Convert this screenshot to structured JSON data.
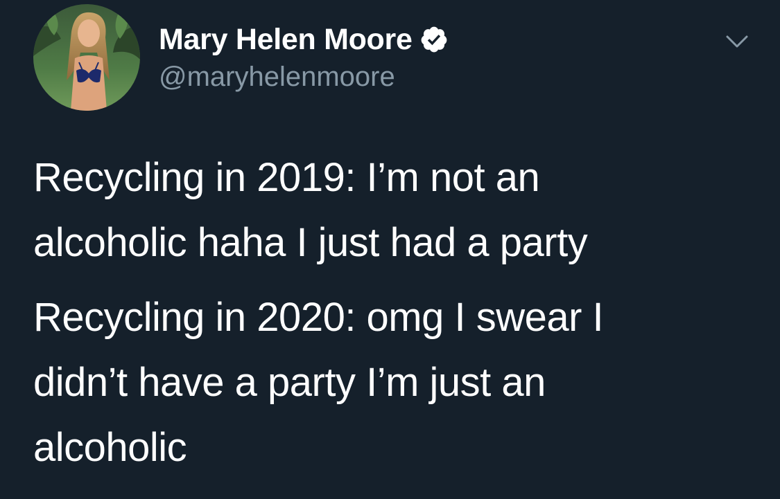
{
  "tweet": {
    "author": {
      "display_name": "Mary Helen Moore",
      "handle": "@maryhelenmoore",
      "verified": true,
      "avatar_icon": "profile-photo"
    },
    "menu_icon": "chevron-down-icon",
    "verified_icon": "verified-badge-icon",
    "paragraphs": [
      {
        "lines": [
          "Recycling in 2019: I’m not an",
          "alcoholic haha I just had a party"
        ]
      },
      {
        "lines": [
          "Recycling in 2020: omg I swear I",
          "didn’t have a party I’m just an",
          "alcoholic"
        ]
      }
    ]
  },
  "colors": {
    "background": "#15202b",
    "text": "#ffffff",
    "secondary_text": "#8899a6"
  }
}
